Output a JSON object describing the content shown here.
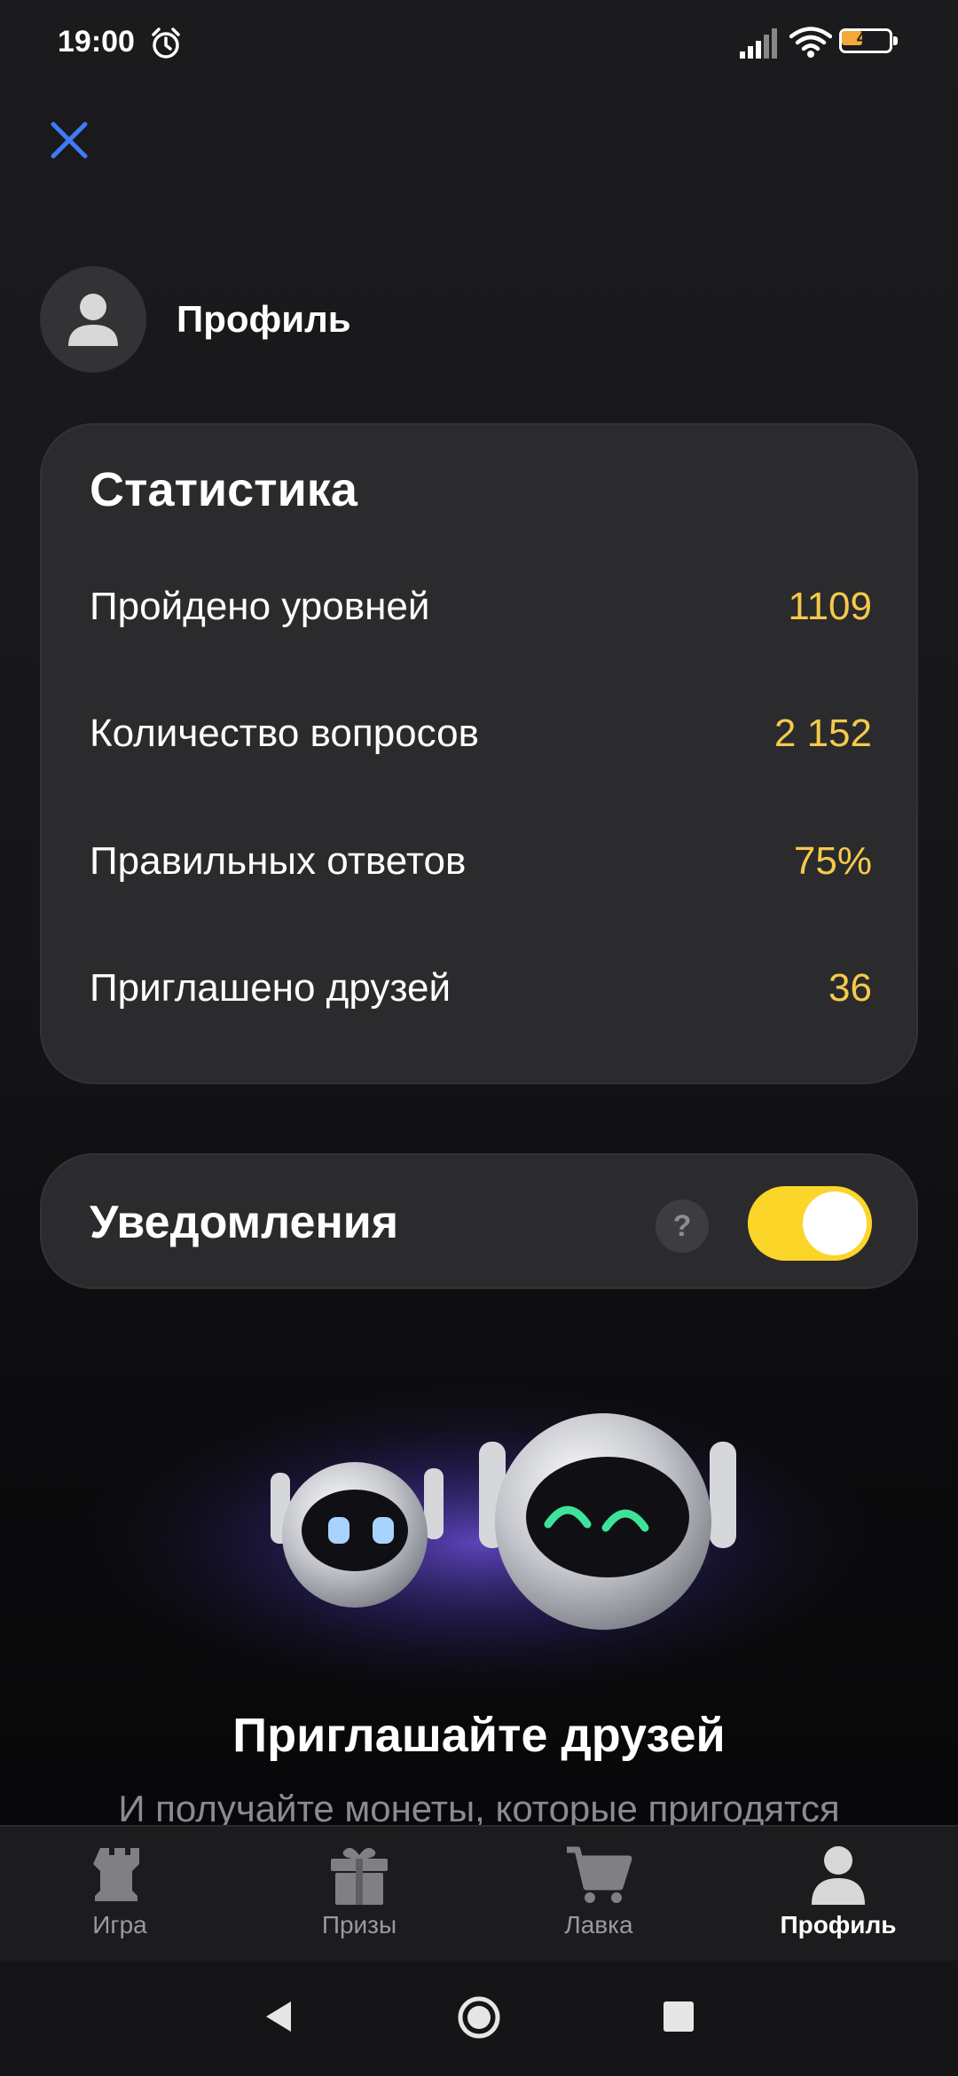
{
  "status_bar": {
    "time": "19:00",
    "battery": "48",
    "battery_level": 0.48
  },
  "profile": {
    "title": "Профиль"
  },
  "stats": {
    "title": "Статистика",
    "rows": [
      {
        "label": "Пройдено уровней",
        "value": "1109"
      },
      {
        "label": "Количество вопросов",
        "value": "2 152"
      },
      {
        "label": "Правильных ответов",
        "value": "75%"
      },
      {
        "label": "Приглашено друзей",
        "value": "36"
      }
    ]
  },
  "notifications": {
    "label": "Уведомления",
    "help": "?",
    "enabled": true
  },
  "promo": {
    "title": "Приглашайте друзей",
    "subtitle": "И получайте монеты, которые пригодятся"
  },
  "nav": {
    "items": [
      {
        "label": "Игра",
        "icon": "chess-rook-icon"
      },
      {
        "label": "Призы",
        "icon": "gift-icon"
      },
      {
        "label": "Лавка",
        "icon": "cart-icon"
      },
      {
        "label": "Профиль",
        "icon": "user-icon",
        "active": true
      }
    ]
  },
  "colors": {
    "accent": "#fbd528",
    "value": "#f6c94b",
    "close": "#3f7bf6"
  }
}
